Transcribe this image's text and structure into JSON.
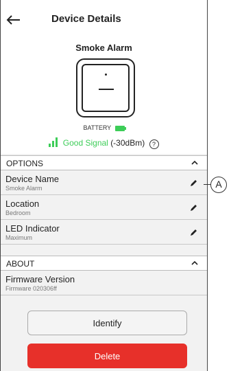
{
  "header": {
    "title": "Device Details"
  },
  "device": {
    "name": "Smoke Alarm",
    "battery_label": "BATTERY",
    "signal_status": "Good Signal",
    "signal_value": "(-30dBm)",
    "help_glyph": "?"
  },
  "options": {
    "label": "OPTIONS",
    "rows": [
      {
        "title": "Device Name",
        "value": "Smoke Alarm"
      },
      {
        "title": "Location",
        "value": "Bedroom"
      },
      {
        "title": "LED Indicator",
        "value": "Maximum"
      }
    ]
  },
  "about": {
    "label": "ABOUT",
    "rows": [
      {
        "title": "Firmware Version",
        "value": "Firmware 020306ff"
      }
    ]
  },
  "buttons": {
    "identify": "Identify",
    "delete": "Delete"
  },
  "callout": {
    "label": "A"
  },
  "colors": {
    "accent_green": "#3dcd58",
    "danger_red": "#e7302a"
  },
  "icons": [
    "back-arrow-icon",
    "battery-icon",
    "signal-icon",
    "help-icon",
    "chevron-up-icon",
    "pencil-icon"
  ]
}
